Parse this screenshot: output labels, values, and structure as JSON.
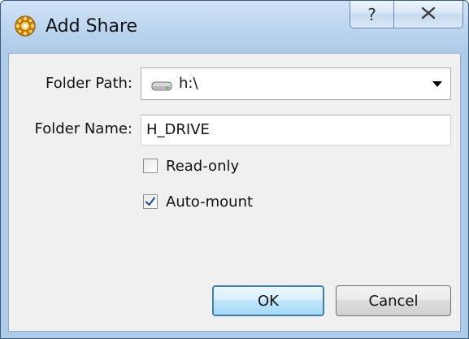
{
  "window": {
    "title": "Add Share",
    "help_label": "?",
    "close_icon": "close-icon"
  },
  "form": {
    "folder_path_label": "Folder Path:",
    "folder_path_value": "h:\\",
    "folder_path_icon": "drive-icon",
    "folder_name_label": "Folder Name:",
    "folder_name_value": "H_DRIVE",
    "read_only_label": "Read-only",
    "read_only_checked": false,
    "auto_mount_label": "Auto-mount",
    "auto_mount_checked": true
  },
  "buttons": {
    "ok_label": "OK",
    "cancel_label": "Cancel"
  },
  "colors": {
    "accent": "#3c7fb1",
    "title_bar": "#b9d3ee",
    "check": "#2b4f8a"
  }
}
